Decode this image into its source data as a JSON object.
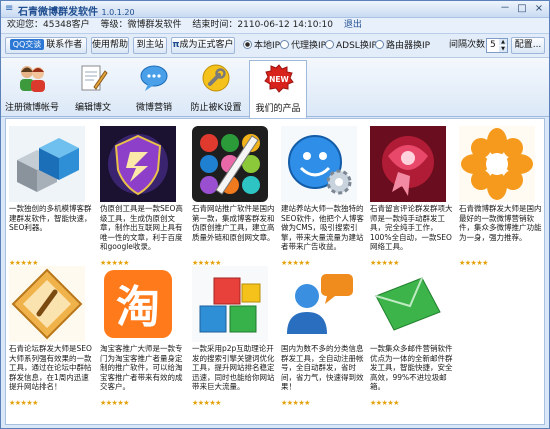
{
  "app": {
    "title": "石青微博群发软件",
    "version": "1.0.1.20",
    "icon": "app-logo-icon",
    "controls": {
      "min": "－",
      "max": "□",
      "close": "×"
    }
  },
  "status": {
    "welcome": "欢迎您：45348客户",
    "level": "等级：微博群发软件",
    "expire": "结束时间：2110-06-12 14:10:10",
    "logout": "退出"
  },
  "toolbar": {
    "qq_badge": "QQ交谈",
    "contact": "联系作者",
    "help": "使用帮助",
    "home": "到主站",
    "upgrade": "成为正式客户",
    "radios": [
      {
        "label": "本地IP",
        "checked": true
      },
      {
        "label": "代理换IP",
        "checked": false
      },
      {
        "label": "ADSL换IP",
        "checked": false
      },
      {
        "label": "路由器换IP",
        "checked": false
      }
    ],
    "interval_label": "间隔次数",
    "interval_value": "5",
    "config": "配置..."
  },
  "tabs": [
    {
      "label": "注册微博帐号",
      "icon": "users-icon"
    },
    {
      "label": "编辑博文",
      "icon": "edit-document-icon"
    },
    {
      "label": "微博营销",
      "icon": "speech-bubble-icon"
    },
    {
      "label": "防止被K设置",
      "icon": "wrench-icon"
    },
    {
      "label": "我们的产品",
      "icon": "new-badge-icon",
      "active": true
    }
  ],
  "products": [
    {
      "icon": "blue-cubes-icon",
      "desc": "一款独创的多机模博客群建群发软件，智能快速，SEO利器。",
      "stars": "★★★★★"
    },
    {
      "icon": "purple-shield-icon",
      "desc": "伪原创工具是一款SEO高级工具，生成伪原创文章，制作出互联网上具有唯一性的文章，利于百度和google收录。",
      "stars": "★★★★★"
    },
    {
      "icon": "color-dots-pencil-icon",
      "desc": "石青网站推广软件是国内第一款，集成博客群发和伪原创推广工具，建立高质量外链和原创网文章。",
      "stars": "★★★★★"
    },
    {
      "icon": "blue-smiley-gear-icon",
      "desc": "建站养站大师一款独特的SEO软件，他把个人博客做为CMS，吸引搜索引擎，带来大量流量为建站者带来广告收益。",
      "stars": "★★★★★"
    },
    {
      "icon": "red-ribbon-icon",
      "desc": "石青留言评论群发群项大师是一款纯手动群发工具，完全纯手工作，100%全自动，一款SEO网络工具。",
      "stars": "★★★★★"
    },
    {
      "icon": "orange-flower-icon",
      "desc": "石青微博群发大师是国内最好的一款微博营销软件，集众多微博推广功能为一身，强力推荐。",
      "stars": "★★★★★"
    },
    {
      "icon": "orange-diamond-icon",
      "desc": "石青论坛群发大师是SEO大师系列强有效果的一款工具，通过在论坛中群帖群发信息，在1周内迅速提升网站排名！",
      "stars": "★★★★★"
    },
    {
      "icon": "taobao-icon",
      "desc": "淘宝客推广大师是一款专门为淘宝客推广者量身定制的推广软件，可以给淘宝客推广者带来有效的成交客户。",
      "stars": "★★★★★"
    },
    {
      "icon": "colored-blocks-icon",
      "desc": "一款采用p2p互助理论开发的搜索引擎关键词优化工具，提升网站排名稳定迅速，同时也能给你网站带来巨大流量。",
      "stars": "★★★★★"
    },
    {
      "icon": "user-speech-icon",
      "desc": "国内为数不多的分类信息群发工具，全自动注册帐号，全自动群发，省时间，省力气，快速得到效果！",
      "stars": "★★★★★"
    },
    {
      "icon": "green-envelope-icon",
      "desc": "一款集众多邮件营销软件优点为一体的全新邮件群发工具，智能快捷，安全高效，99%不进垃圾邮箱。",
      "stars": "★★★★★"
    }
  ],
  "colors": {
    "accent": "#2c78d4",
    "title": "#1f4d8f",
    "star": "#e4a20c"
  }
}
